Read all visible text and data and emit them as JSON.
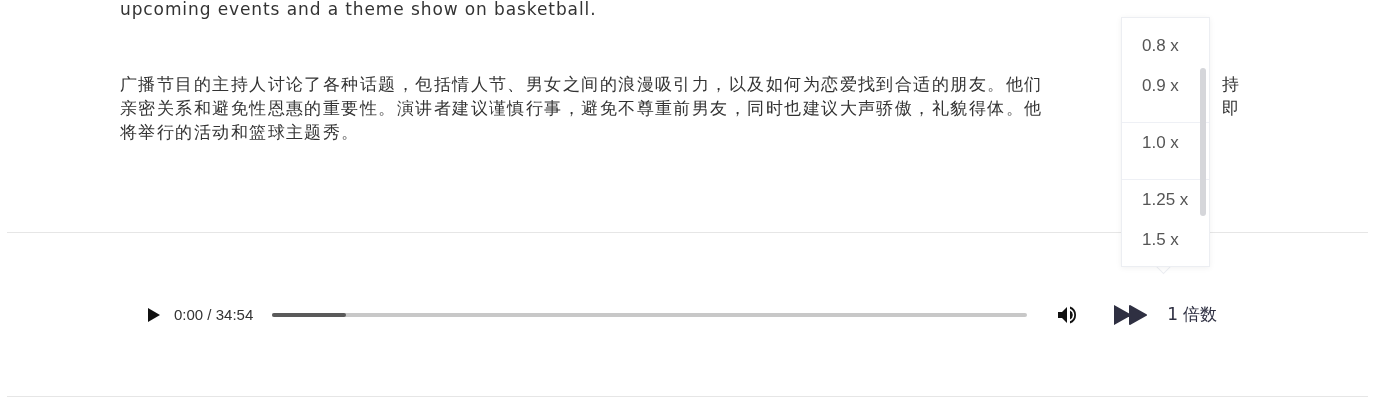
{
  "english_tail": "upcoming events and a theme show on basketball.",
  "chinese_lines": [
    {
      "left": "广播节目的主持人讨论了各种话题，包括情人节、男女之间的浪漫吸引力，以及如何为恋爱找到合适的朋友。他们",
      "right": "持"
    },
    {
      "left": "亲密关系和避免性恩惠的重要性。演讲者建议谨慎行事，避免不尊重前男友，同时也建议大声骄傲，礼貌得体。他",
      "right": "即"
    },
    {
      "left": "将举行的活动和篮球主题秀。"
    }
  ],
  "speed_menu": {
    "options": [
      "0.8 x",
      "0.9 x",
      "1.0 x",
      "1.25 x",
      "1.5 x"
    ]
  },
  "player": {
    "time": "0:00 / 34:54",
    "level": 0.098,
    "speed_label": "1 倍数"
  }
}
